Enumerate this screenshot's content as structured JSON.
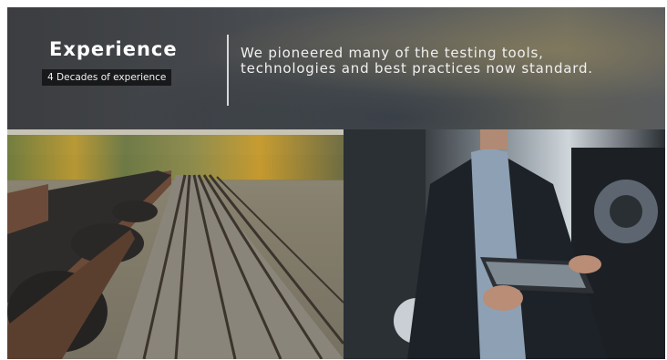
{
  "banner": {
    "title": "Experience",
    "badge": "4 Decades of experience",
    "tagline_line1": "We pioneered many of the testing tools,",
    "tagline_line2": "technologies and best practices now standard."
  },
  "images": {
    "left": "railway-coal-train-image",
    "right": "engineer-with-tablet-image"
  },
  "colors": {
    "banner_text": "#ffffff",
    "badge_background": "#17191b",
    "divider": "#d8d8d8"
  }
}
